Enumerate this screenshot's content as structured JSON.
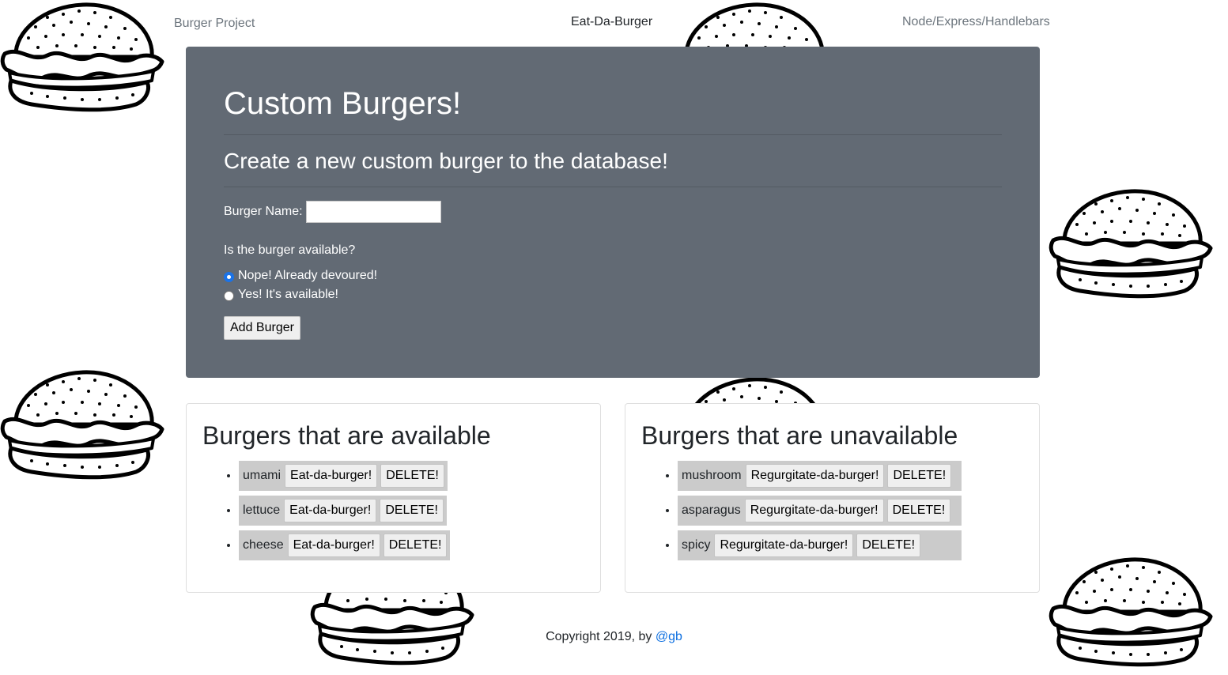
{
  "nav": {
    "left_link": "Burger Project",
    "brand": "Eat-Da-Burger",
    "right_link": "Node/Express/Handlebars"
  },
  "jumbotron": {
    "title": "Custom Burgers!",
    "subtitle": "Create a new custom burger to the database!",
    "name_label": "Burger Name:",
    "name_value": "",
    "question": "Is the burger available?",
    "radio_options": [
      {
        "label": "Nope! Already devoured!",
        "checked": true
      },
      {
        "label": "Yes! It's available!",
        "checked": false
      }
    ],
    "add_button": "Add Burger"
  },
  "available": {
    "heading": "Burgers that are available",
    "action_label": "Eat-da-burger!",
    "delete_label": "DELETE!",
    "items": [
      "umami",
      "lettuce",
      "cheese"
    ]
  },
  "unavailable": {
    "heading": "Burgers that are unavailable",
    "action_label": "Regurgitate-da-burger!",
    "delete_label": "DELETE!",
    "items": [
      "mushroom",
      "asparagus",
      "spicy"
    ]
  },
  "footer": {
    "text": "Copyright 2019, by ",
    "link": "@gb"
  },
  "colors": {
    "jumbotron_bg": "#626a74",
    "item_bg": "#cbcbcb",
    "link": "#0b6ee0"
  },
  "decorations": {
    "background_icon": "burger-icon"
  }
}
